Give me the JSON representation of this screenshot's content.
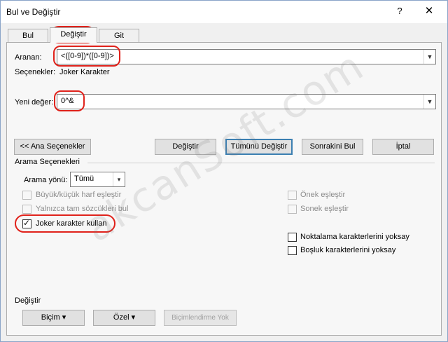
{
  "window": {
    "title": "Bul ve Değiştir",
    "help_glyph": "?",
    "close_glyph": "✕"
  },
  "tabs": [
    {
      "label": "Bul",
      "active": false
    },
    {
      "label": "Değiştir",
      "active": true
    },
    {
      "label": "Git",
      "active": false
    }
  ],
  "find": {
    "label": "Aranan:",
    "value": "<([0-9])*([0-9])>"
  },
  "options_line": {
    "label": "Seçenekler:",
    "value": "Joker Karakter"
  },
  "replace": {
    "label": "Yeni değer:",
    "value": "0^&"
  },
  "buttons": {
    "less": "<< Ana Seçenekler",
    "replace": "Değiştir",
    "replace_all": "Tümünü Değiştir",
    "find_next": "Sonrakini Bul",
    "cancel": "İptal"
  },
  "search_options": {
    "group_title": "Arama Seçenekleri",
    "direction_label": "Arama yönü:",
    "direction_value": "Tümü",
    "checkboxes_left": [
      {
        "label": "Büyük/küçük harf eşleştir",
        "checked": false,
        "enabled": false
      },
      {
        "label": "Yalnızca tam sözcükleri bul",
        "checked": false,
        "enabled": false
      },
      {
        "label": "Joker karakter kullan",
        "checked": true,
        "enabled": true
      }
    ],
    "checkboxes_right": [
      {
        "label": "Önek eşleştir",
        "checked": false,
        "enabled": false
      },
      {
        "label": "Sonek eşleştir",
        "checked": false,
        "enabled": false
      },
      {
        "label": "Noktalama karakterlerini yoksay",
        "checked": false,
        "enabled": true
      },
      {
        "label": "Boşluk karakterlerini yoksay",
        "checked": false,
        "enabled": true
      }
    ]
  },
  "replace_section": {
    "title": "Değiştir",
    "format": "Biçim ▾",
    "special": "Özel ▾",
    "no_formatting": "Biçimlendirme Yok"
  },
  "watermark": "akcanSoft.com",
  "annotation_color": "#e0221b"
}
